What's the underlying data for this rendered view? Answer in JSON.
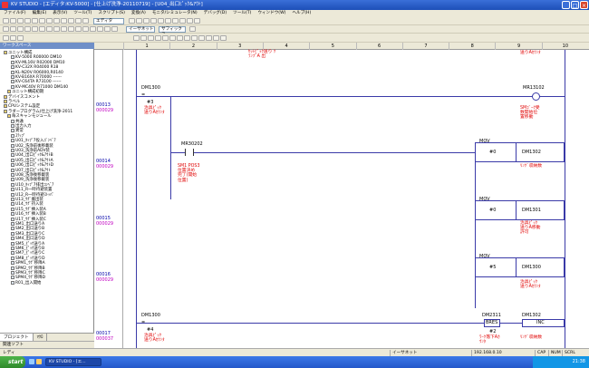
{
  "window": {
    "title": "KV STUDIO - [エディタ:KV-5000] - [仕上げ洗浄-20110719] - [U04_出口ﾋﾟｯｸ&ｱｳﾄ]"
  },
  "menu": [
    "ファイル(F)",
    "編集(E)",
    "表示(V)",
    "ツール(T)",
    "スクリプト(S)",
    "変換(A)",
    "モニタ/シミュレータ(N)",
    "デバッグ(D)",
    "ツール(T)",
    "ウィンドウ(W)",
    "ヘルプ(H)"
  ],
  "toolbar": {
    "mode_combo": "エディタ",
    "ethernet_combo": "イーサネット",
    "suffix_combo": "サフィックス"
  },
  "workspace": {
    "header": "ワークスペース",
    "tree": [
      {
        "label": "ユニット構成",
        "indent": 1
      },
      {
        "label": "KV-5000   R00000 DM10",
        "indent": 3
      },
      {
        "label": "KV-ML16V  R02000 DM10",
        "indent": 3
      },
      {
        "label": "KV-C32X   R04000 R18",
        "indent": 3
      },
      {
        "label": "KL-N20V   R06000,R0140",
        "indent": 3
      },
      {
        "label": "KV-B16XA  R70000 ------",
        "indent": 3
      },
      {
        "label": "KV-C64TA  R73100 ------",
        "indent": 3
      },
      {
        "label": "KV-MC40V  R71000 DM140",
        "indent": 3
      },
      {
        "label": "ユニット構成初期",
        "indent": 2
      },
      {
        "label": "デバイスコメント",
        "indent": 1
      },
      {
        "label": "ラベル",
        "indent": 1
      },
      {
        "label": "CPUシステム設定",
        "indent": 1
      },
      {
        "label": "ラダープログラム(仕上げ洗浄-2011",
        "indent": 1
      },
      {
        "label": "毎スキャンモジュール",
        "indent": 2
      },
      {
        "label": "共通",
        "indent": 3
      },
      {
        "label": "出力入力",
        "indent": 3
      },
      {
        "label": "異常",
        "indent": 3
      },
      {
        "label": "ｽﾃｯﾌﾟ",
        "indent": 3
      },
      {
        "label": "U01_ﾀｯﾌﾟ7投入ｺﾞﾝﾍﾞｱ",
        "indent": 3
      },
      {
        "label": "U02_洗浄前後移載装",
        "indent": 3
      },
      {
        "label": "U03_洗浄前ADV装",
        "indent": 3
      },
      {
        "label": "U04_出口ﾋﾟｯｸ&ｱｳﾄB",
        "indent": 3
      },
      {
        "label": "U05_出口ﾋﾟｯｸ&ｱｳﾄA",
        "indent": 3
      },
      {
        "label": "U06_出口ﾋﾟｯｸ&ｱｳﾄD",
        "indent": 3
      },
      {
        "label": "U07_出口ﾋﾟｯｸ&ｱｳﾄ",
        "indent": 3
      },
      {
        "label": "U08_洗浄後移載装",
        "indent": 3
      },
      {
        "label": "U09_洗浄後移載装",
        "indent": 3
      },
      {
        "label": "U10_ﾀｯﾌﾟ7排出ｺﾝﾍﾞｱ",
        "indent": 3
      },
      {
        "label": "U11_R一時待避装置",
        "indent": 3
      },
      {
        "label": "U12_R一時待避ｽﾄｯﾊﾟ",
        "indent": 3
      },
      {
        "label": "U13_ｳｸﾞ搬出装",
        "indent": 3
      },
      {
        "label": "U14_ｳｸﾞ持入装",
        "indent": 3
      },
      {
        "label": "U15_ｳｸﾞ挿入装A",
        "indent": 3
      },
      {
        "label": "U16_ｳｸﾞ挿入装B",
        "indent": 3
      },
      {
        "label": "U17_ｳｸﾞ挿入装C",
        "indent": 3
      },
      {
        "label": "SM1_出口送りA",
        "indent": 3
      },
      {
        "label": "SM2_出口送りB",
        "indent": 3
      },
      {
        "label": "SM3_出口送りC",
        "indent": 3
      },
      {
        "label": "SM4_出口送りD",
        "indent": 3
      },
      {
        "label": "SM5_ﾋﾟｯｸ送りA",
        "indent": 3
      },
      {
        "label": "SM6_ﾋﾟｯｸ送りB",
        "indent": 3
      },
      {
        "label": "SM7_ﾋﾟｯｸ送りC",
        "indent": 3
      },
      {
        "label": "SM8_ﾋﾟｯｸ送りD",
        "indent": 3
      },
      {
        "label": "SPM1_ｳｸﾞ移降A",
        "indent": 3
      },
      {
        "label": "SPM2_ｳｸﾞ移降B",
        "indent": 3
      },
      {
        "label": "SPM3_ｳｸﾞ移降C",
        "indent": 3
      },
      {
        "label": "SPM4_ｳｸﾞ移降D",
        "indent": 3
      },
      {
        "label": "R01_出入開始",
        "indent": 3
      }
    ],
    "tabs": [
      "プロジェクト",
      "ﾏｸﾛ"
    ],
    "bottom": "関連ソフト"
  },
  "editor": {
    "columns": [
      "1",
      "2",
      "3",
      "4",
      "5",
      "6",
      "7",
      "8",
      "9",
      "10"
    ],
    "top_comment_mid": "ｾｯﾄﾋﾟｯｸ送り ｸ\nﾗﾝﾌﾟA 出",
    "top_comment_right": "送りAｶｳﾝﾀ",
    "rows": [
      {
        "row": "00013",
        "step": "000029"
      },
      {
        "row": "00014",
        "step": "000029"
      },
      {
        "row": "00015",
        "step": "000029"
      },
      {
        "row": "00016",
        "step": "000029"
      },
      {
        "row": "00017",
        "step": "000037"
      }
    ],
    "r13": {
      "device": "DM1300",
      "op": "=",
      "const": "#3",
      "comment": "治具ﾋﾟｯｸ\n送りAｶｳﾝﾀ",
      "coil": "MR13102",
      "coil_comment": "SMｺﾞｰｸ受\n数開始位\n置移動"
    },
    "r14": {
      "contact": "MR30202",
      "contact_comment": "SM1 POS3\n位置決め\n完了(開始\n位置)",
      "inst": "MOV",
      "src": "#0",
      "dst": "DM1302",
      "dst_comment": "ﾘﾝｸﾞ収納数"
    },
    "r15": {
      "inst": "MOV",
      "src": "#0",
      "dst": "DM1301",
      "dst_comment": "治具ﾋﾟｯｸ\n送りA移動\n許可"
    },
    "r16": {
      "inst": "MOV",
      "src": "#5",
      "dst": "DM1300",
      "dst_comment": "治具ﾋﾟｯｸ\n送りAｶｳﾝﾀ"
    },
    "r17": {
      "device": "DM1300",
      "op": "=",
      "const": "#4",
      "comment": "治具ﾋﾟｯｸ\n送りAｶｳﾝﾀ",
      "bres_dev": "DM2311",
      "bres": "BRES",
      "bres_arg": "#2",
      "bres_comment": "ﾜｰｸ落下Aｶ\nｳﾝﾀ",
      "inc_dev": "DM1302",
      "inc": "INC",
      "inc_comment": "ﾘﾝｸﾞ収納数"
    }
  },
  "status": {
    "left": "レディ",
    "conn": "イーサネット",
    "addr": "192.168.0.10",
    "flags": [
      "CAP",
      "NUM",
      "SCRL"
    ]
  },
  "taskbar": {
    "start": "start",
    "item": "KV STUDIO - [エ...",
    "clock": "21:38"
  },
  "colors": {
    "rail": "#3a3aa8",
    "comment": "#e00000",
    "row_number": "#0000aa",
    "step_number": "#c000c0"
  }
}
